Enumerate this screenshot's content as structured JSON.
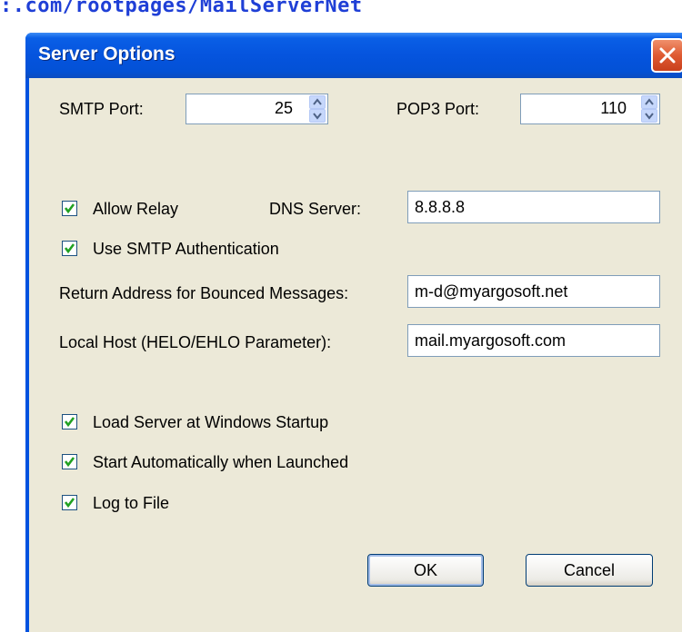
{
  "background": {
    "url_text": ":.com/rootpages/MailServerNet"
  },
  "dialog": {
    "title": "Server Options",
    "smtp_port": {
      "label": "SMTP Port:",
      "value": "25"
    },
    "pop3_port": {
      "label": "POP3 Port:",
      "value": "110"
    },
    "allow_relay": {
      "label": "Allow Relay",
      "checked": true
    },
    "dns_server": {
      "label": "DNS Server:",
      "value": "8.8.8.8"
    },
    "use_smtp_auth": {
      "label": "Use SMTP Authentication",
      "checked": true
    },
    "return_address": {
      "label": "Return Address for Bounced Messages:",
      "value": "m-d@myargosoft.net"
    },
    "local_host": {
      "label": "Local Host (HELO/EHLO Parameter):",
      "value": "mail.myargosoft.com"
    },
    "load_at_startup": {
      "label": "Load Server at Windows Startup",
      "checked": true
    },
    "start_automatically": {
      "label": "Start Automatically when Launched",
      "checked": true
    },
    "log_to_file": {
      "label": "Log to File",
      "checked": true
    },
    "ok_label": "OK",
    "cancel_label": "Cancel"
  },
  "colors": {
    "title_bar": "#0554de",
    "client": "#ece9d8",
    "checkmark": "#21a121",
    "close": "#df5a32"
  },
  "icons": [
    "close-icon",
    "spin-up-icon",
    "spin-down-icon",
    "checkmark-icon"
  ]
}
